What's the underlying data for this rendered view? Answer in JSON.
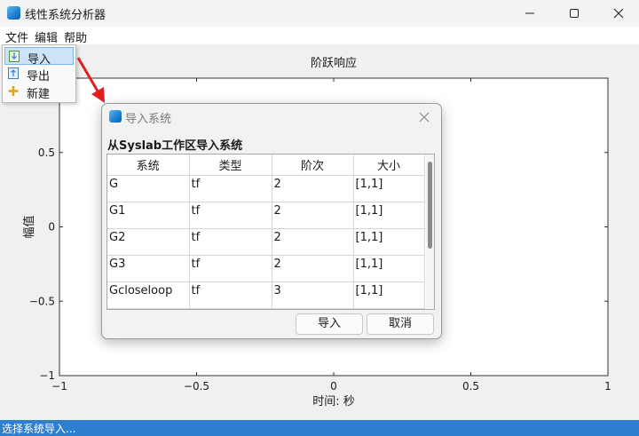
{
  "window": {
    "title": "线性系统分析器"
  },
  "menubar": {
    "file": "文件",
    "edit": "编辑",
    "help": "帮助"
  },
  "file_menu": {
    "items": [
      {
        "label": "导入",
        "icon": "import-icon",
        "active": true
      },
      {
        "label": "导出",
        "icon": "export-icon",
        "active": false
      },
      {
        "label": "新建",
        "icon": "plus-icon",
        "active": false
      }
    ]
  },
  "chart_data": {
    "type": "line",
    "title": "阶跃响应",
    "xlabel": "时间: 秒",
    "ylabel": "幅值",
    "xlim": [
      -1,
      1
    ],
    "ylim": [
      -1,
      1
    ],
    "xticks": [
      "−1",
      "−0.5",
      "0",
      "0.5",
      "1"
    ],
    "yticks": [
      "−1",
      "−0.5",
      "0",
      "0.5",
      "1"
    ],
    "series": []
  },
  "dialog": {
    "title": "导入系统",
    "heading": "从Syslab工作区导入系统",
    "columns": [
      "系统",
      "类型",
      "阶次",
      "大小"
    ],
    "rows": [
      [
        "G",
        "tf",
        "2",
        "[1,1]"
      ],
      [
        "G1",
        "tf",
        "2",
        "[1,1]"
      ],
      [
        "G2",
        "tf",
        "2",
        "[1,1]"
      ],
      [
        "G3",
        "tf",
        "2",
        "[1,1]"
      ],
      [
        "Gcloseloop",
        "tf",
        "3",
        "[1,1]"
      ]
    ],
    "import_button": "导入",
    "cancel_button": "取消"
  },
  "status": {
    "text": "选择系统导入..."
  },
  "colors": {
    "accent": "#2f7fd1",
    "arrow": "#e0201e",
    "selection": "#cce4f7"
  }
}
